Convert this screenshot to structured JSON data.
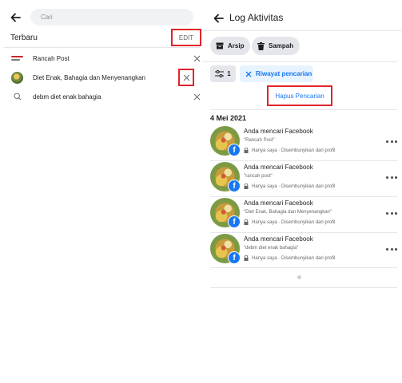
{
  "left_panel": {
    "search": {
      "placeholder": "Cari"
    },
    "recent": {
      "label": "Terbaru",
      "edit_label": "EDIT",
      "items": [
        {
          "label": "Rancah Post",
          "thumb": "rancah-post-logo"
        },
        {
          "label": "Diet Enak, Bahagia dan Menyenangkan",
          "thumb": "food-thumbnail"
        },
        {
          "label": "debm diet enak bahagia",
          "thumb": "search-icon"
        }
      ]
    }
  },
  "right_panel": {
    "title": "Log Aktivitas",
    "buttons": {
      "archive": "Arsip",
      "trash": "Sampah"
    },
    "filters": {
      "count": "1",
      "active_tag": "Riwayat pencarian"
    },
    "clear_search_label": "Hapus Pencarian",
    "date_heading": "4 Mei 2021",
    "activities": [
      {
        "title": "Anda mencari Facebook",
        "query": "\"Rancah Post\"",
        "privacy": "Hanya saya · Disembunyikan dari profil"
      },
      {
        "title": "Anda mencari Facebook",
        "query": "\"rancah post\"",
        "privacy": "Hanya saya · Disembunyikan dari profil"
      },
      {
        "title": "Anda mencari Facebook",
        "query": "\"Diet Enak, Bahagia dan Menyenangkan\"",
        "privacy": "Hanya saya · Disembunyikan dari profil"
      },
      {
        "title": "Anda mencari Facebook",
        "query": "\"debm diet enak bahagia\"",
        "privacy": "Hanya saya · Disembunyikan dari profil"
      }
    ],
    "badge_glyph": "f"
  },
  "colors": {
    "highlight_box": "#e0242c",
    "facebook_blue": "#1877f2",
    "chip_bg": "#e4e6eb",
    "tag_bg": "#e7f3ff"
  }
}
